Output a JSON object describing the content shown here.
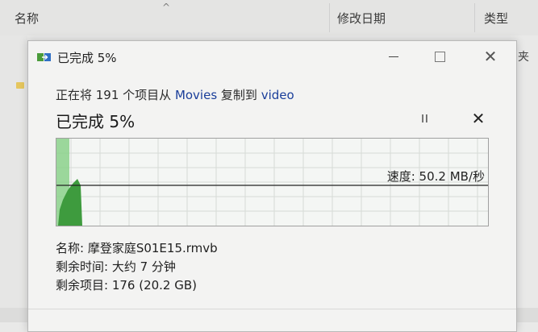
{
  "explorer": {
    "columns": [
      "名称",
      "修改日期",
      "类型"
    ],
    "right_partial": "夹"
  },
  "dialog": {
    "title": "已完成 5%",
    "description": {
      "prefix": "正在将 191 个项目从 ",
      "source": "Movies",
      "middle": " 复制到 ",
      "destination": "video"
    },
    "progress_label": "已完成 5%",
    "progress": 0.05,
    "speed_text": "速度: 50.2 MB/秒",
    "pause_icon": "pause-icon",
    "cancel_icon": "close-icon",
    "details": {
      "name_label": "名称: ",
      "name_value": "摩登家庭S01E15.rmvb",
      "time_label": "剩余时间: ",
      "time_value": "大约 7 分钟",
      "items_label": "剩余项目: ",
      "items_value": "176 (20.2 GB)"
    }
  },
  "colors": {
    "progress_fill": "#8bd18b",
    "graph_green": "#3e9b3e",
    "link": "#1a3e9a"
  }
}
